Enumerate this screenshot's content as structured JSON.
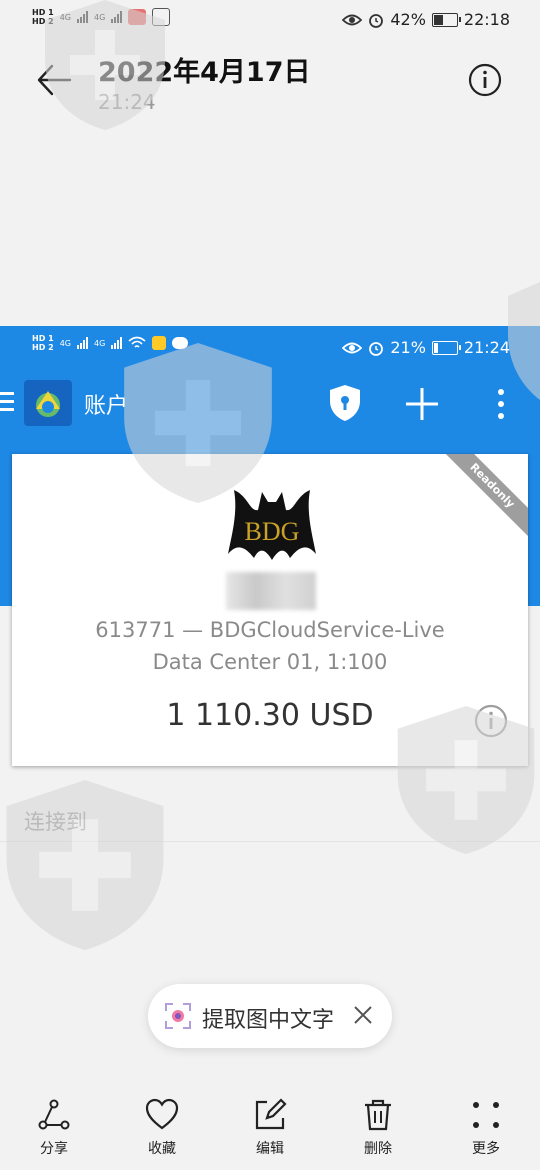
{
  "status_bar": {
    "sim_labels": [
      "HD 1",
      "HD 2"
    ],
    "network": [
      "4G",
      "4G"
    ],
    "battery": "42%",
    "battery_level": 0.42,
    "time": "22:18"
  },
  "gallery_header": {
    "title": "2022年4月17日",
    "time": "21:24",
    "back_icon": "arrow-left-icon",
    "info_icon": "info-icon"
  },
  "screenshot": {
    "status_bar": {
      "sim_labels": [
        "HD 1",
        "HD 2"
      ],
      "network": [
        "4G",
        "4G"
      ],
      "battery": "21%",
      "battery_level": 0.21,
      "time": "21:24"
    },
    "app_bar": {
      "title": "账户",
      "accent_color": "#1e88e5"
    },
    "account_card": {
      "ribbon": "Readonly",
      "logo_text": "BDG",
      "line1": "613771 — BDGCloudService-Live",
      "line2": "Data Center 01, 1:100",
      "balance": "1 110.30 USD"
    },
    "connect_label": "连接到"
  },
  "extract_text": {
    "label": "提取图中文字"
  },
  "toolbar": {
    "items": [
      {
        "label": "分享",
        "icon": "share-icon"
      },
      {
        "label": "收藏",
        "icon": "heart-icon"
      },
      {
        "label": "编辑",
        "icon": "edit-icon"
      },
      {
        "label": "删除",
        "icon": "trash-icon"
      },
      {
        "label": "更多",
        "icon": "more-icon"
      }
    ]
  }
}
